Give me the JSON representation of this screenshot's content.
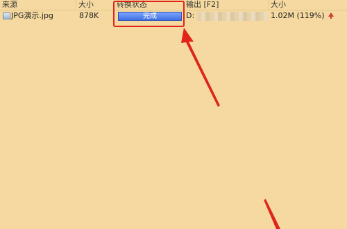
{
  "columns": {
    "source": "来源",
    "size": "大小",
    "status": "转换状态",
    "output": "输出 [F2]",
    "out_size": "大小"
  },
  "row": {
    "file_name": "JPG演示.jpg",
    "size": "878K",
    "status": "完成",
    "progress_percent": 100,
    "output_path": "D:",
    "out_size": "1.02M (119%)"
  },
  "colors": {
    "background": "#f5d9a0",
    "progress": "#4f7ff0",
    "annotation": "#e0241a",
    "upload_icon": "#d43b2f"
  },
  "icons": [
    "image-file-icon",
    "upload-arrow-icon"
  ]
}
